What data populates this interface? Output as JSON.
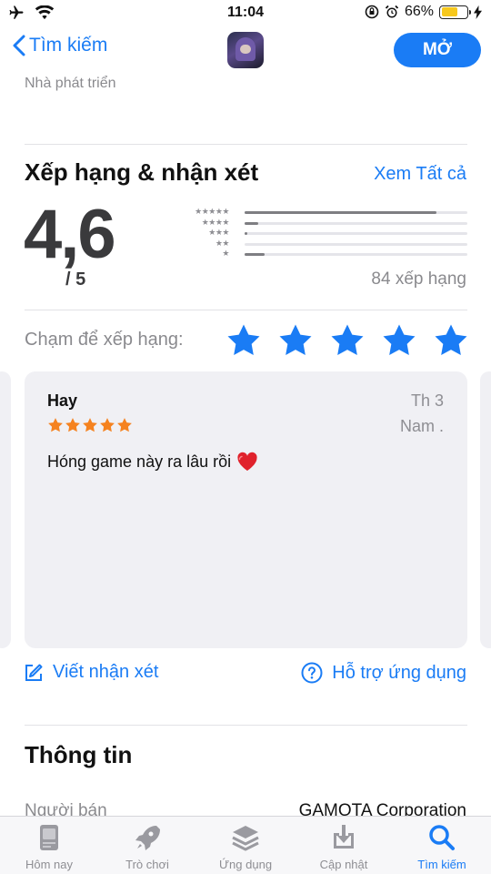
{
  "status_bar": {
    "time": "11:04",
    "battery_percent": "66%",
    "battery_level": 0.66
  },
  "nav": {
    "back_label": "Tìm kiếm",
    "open_label": "MỞ"
  },
  "developer_label": "Nhà phát triển",
  "ratings": {
    "title": "Xếp hạng & nhận xét",
    "see_all": "Xem Tất cả",
    "score": "4,6",
    "out_of": "/ 5",
    "count_label": "84 xếp hạng",
    "histogram": [
      {
        "stars": 5,
        "fraction": 0.86
      },
      {
        "stars": 4,
        "fraction": 0.06
      },
      {
        "stars": 3,
        "fraction": 0.01
      },
      {
        "stars": 2,
        "fraction": 0.0
      },
      {
        "stars": 1,
        "fraction": 0.09
      }
    ],
    "tap_to_rate": "Chạm để xếp hạng:"
  },
  "review": {
    "title": "Hay",
    "date": "Th 3",
    "author": "Nam .",
    "stars": 5,
    "body": "Hóng game này ra lâu rồi"
  },
  "actions": {
    "write_review": "Viết nhận xét",
    "app_support": "Hỗ trợ ứng dụng"
  },
  "info": {
    "title": "Thông tin",
    "seller_label": "Người bán",
    "seller_value": "GAMOTA Corporation"
  },
  "tabs": [
    {
      "label": "Hôm nay",
      "icon": "today-icon",
      "active": false
    },
    {
      "label": "Trò chơi",
      "icon": "rocket-icon",
      "active": false
    },
    {
      "label": "Ứng dụng",
      "icon": "layers-icon",
      "active": false
    },
    {
      "label": "Cập nhật",
      "icon": "download-icon",
      "active": false
    },
    {
      "label": "Tìm kiếm",
      "icon": "search-icon",
      "active": true
    }
  ],
  "colors": {
    "accent": "#1a7cf5",
    "review_star": "#f5821f",
    "battery": "#f7c81c"
  }
}
